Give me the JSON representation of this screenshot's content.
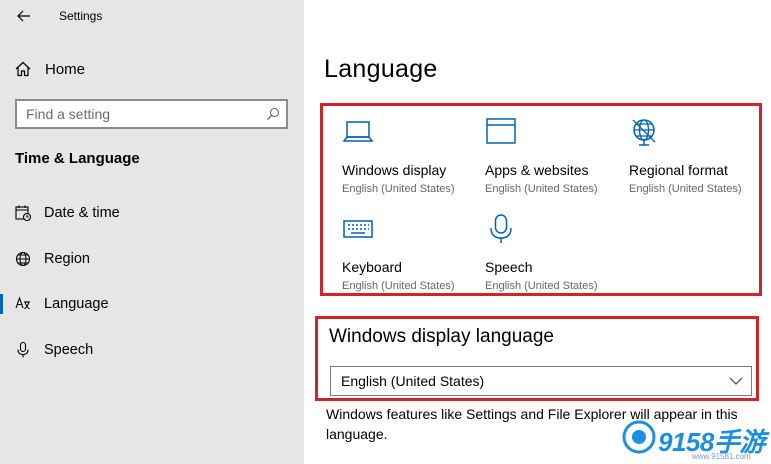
{
  "window": {
    "title": "Settings"
  },
  "sidebar": {
    "home_label": "Home",
    "search_placeholder": "Find a setting",
    "section_title": "Time & Language",
    "items": [
      {
        "label": "Date & time",
        "icon": "calendar-clock-icon",
        "selected": false
      },
      {
        "label": "Region",
        "icon": "globe-icon",
        "selected": false
      },
      {
        "label": "Language",
        "icon": "language-icon",
        "selected": true
      },
      {
        "label": "Speech",
        "icon": "microphone-icon",
        "selected": false
      }
    ]
  },
  "main": {
    "title": "Language",
    "tiles": [
      {
        "name": "Windows display",
        "sub": "English (United States)",
        "icon": "laptop-icon"
      },
      {
        "name": "Apps & websites",
        "sub": "English (United States)",
        "icon": "window-icon"
      },
      {
        "name": "Regional format",
        "sub": "English (United States)",
        "icon": "globe-icon"
      },
      {
        "name": "Keyboard",
        "sub": "English (United States)",
        "icon": "keyboard-icon"
      },
      {
        "name": "Speech",
        "sub": "English (United States)",
        "icon": "microphone-icon"
      }
    ],
    "display_language": {
      "heading": "Windows display language",
      "selected": "English (United States)",
      "description": "Windows features like Settings and File Explorer will appear in this language."
    }
  },
  "watermark": {
    "brand": "9158手游",
    "url": "www.91581.com"
  },
  "colors": {
    "accent": "#0067c0",
    "highlight": "#d2232a",
    "icon_blue": "#0063b1",
    "sidebar_bg": "#e6e6e6"
  }
}
